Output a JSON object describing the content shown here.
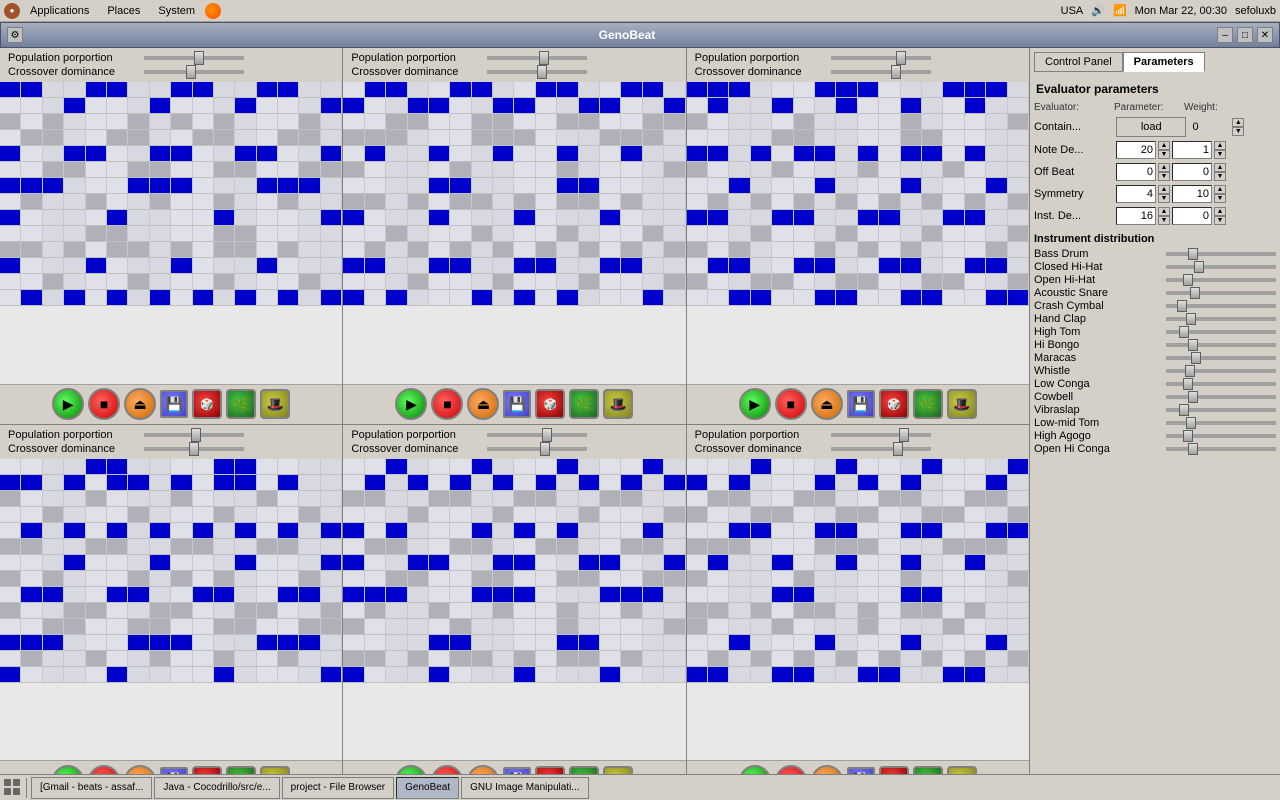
{
  "menubar": {
    "left_items": [
      "Applications",
      "Places",
      "System"
    ],
    "right_items": [
      "USA",
      "Mon Mar 22, 00:30",
      "sefoluxb"
    ]
  },
  "window": {
    "title": "GenoBeat",
    "min_label": "–",
    "max_label": "□",
    "close_label": "✕"
  },
  "panels": {
    "population_label": "Population porportion",
    "crossover_label": "Crossover dominance",
    "rows_count": 14,
    "transport_buttons": [
      "▶",
      "■",
      "●",
      "💾",
      "🎲",
      "🌿",
      "🎩"
    ]
  },
  "right_panel": {
    "tabs": [
      "Control Panel",
      "Parameters"
    ],
    "active_tab": "Parameters",
    "evaluator_title": "Evaluator parameters",
    "eval_headers": [
      "Evaluator:",
      "Parameter:",
      "Weight:"
    ],
    "evaluators": [
      {
        "label": "Contain...",
        "param": "load",
        "weight": "0"
      },
      {
        "label": "Note De...",
        "param": "20",
        "weight": "1"
      },
      {
        "label": "Off Beat",
        "param": "0",
        "weight": "0"
      },
      {
        "label": "Symmetry",
        "param": "4",
        "weight": "10"
      },
      {
        "label": "Inst. De...",
        "param": "16",
        "weight": "0"
      }
    ],
    "inst_distribution_title": "Instrument distribution",
    "instruments": [
      {
        "name": "Bass Drum",
        "value": 60
      },
      {
        "name": "Closed Hi-Hat",
        "value": 65
      },
      {
        "name": "Open Hi-Hat",
        "value": 55
      },
      {
        "name": "Acoustic Snare",
        "value": 62
      },
      {
        "name": "Crash Cymbal",
        "value": 50
      },
      {
        "name": "Hand Clap",
        "value": 58
      },
      {
        "name": "High Tom",
        "value": 52
      },
      {
        "name": "Hi Bongo",
        "value": 60
      },
      {
        "name": "Maracas",
        "value": 63
      },
      {
        "name": "Whistle",
        "value": 57
      },
      {
        "name": "Low Conga",
        "value": 55
      },
      {
        "name": "Cowbell",
        "value": 60
      },
      {
        "name": "Vibraslap",
        "value": 52
      },
      {
        "name": "Low-mid Tom",
        "value": 58
      },
      {
        "name": "High Agogo",
        "value": 55
      },
      {
        "name": "Open Hi Conga",
        "value": 60
      }
    ]
  },
  "taskbar": {
    "items": [
      "[Gmail - beats - assaf...",
      "Java - Cocodrillo/src/e...",
      "project - File Browser",
      "GenoBeat",
      "GNU Image Manipulati..."
    ]
  }
}
